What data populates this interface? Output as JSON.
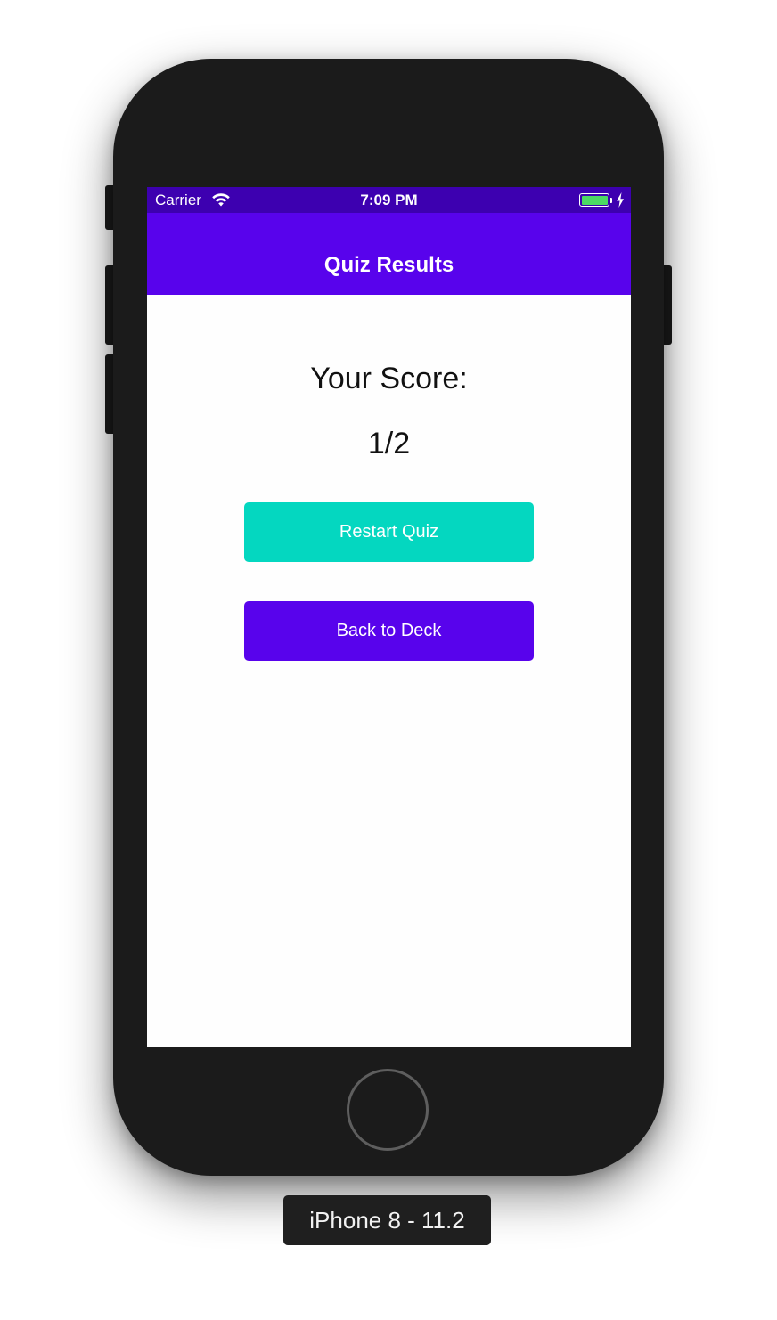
{
  "status_bar": {
    "carrier": "Carrier",
    "time": "7:09 PM",
    "battery_color": "#4cd964"
  },
  "nav": {
    "title": "Quiz Results",
    "background_color": "#5803ec"
  },
  "result": {
    "score_label": "Your Score:",
    "score_value": "1/2"
  },
  "buttons": {
    "restart_label": "Restart Quiz",
    "restart_color": "#04d7c0",
    "back_label": "Back to Deck",
    "back_color": "#5803ec"
  },
  "device": {
    "label": "iPhone 8 - 11.2"
  },
  "icons": [
    "wifi-icon",
    "battery-icon",
    "charging-bolt-icon",
    "home-button"
  ]
}
